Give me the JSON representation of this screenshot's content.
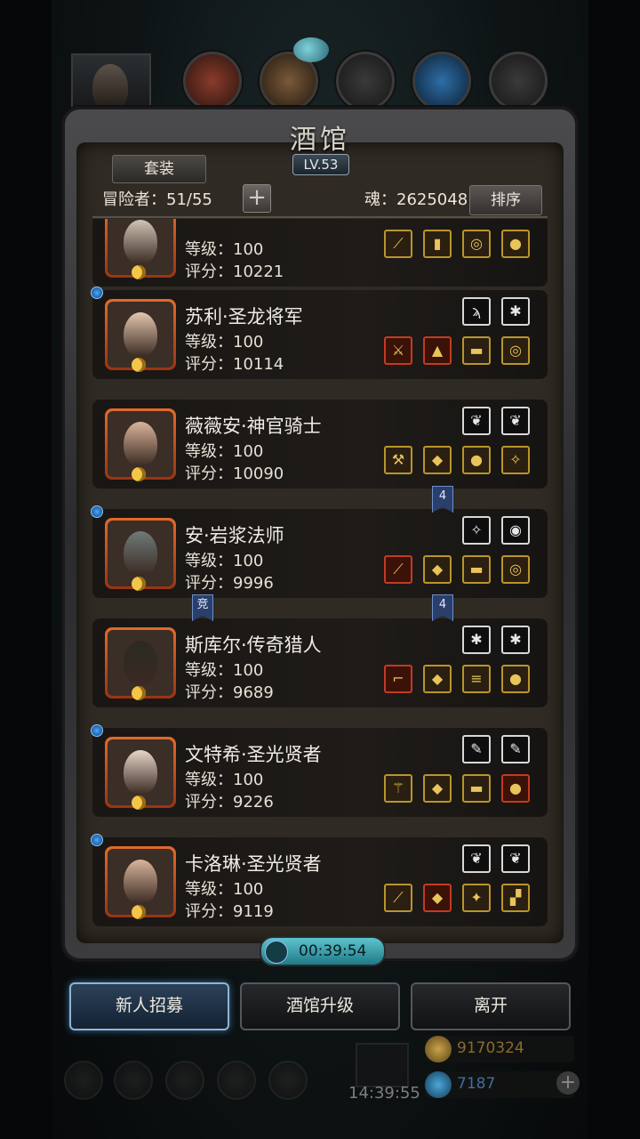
{
  "screen": {
    "title": "酒馆",
    "level_badge": "LV.53",
    "suit_button": "套装",
    "adventurer_label": "冒险者：51/55",
    "add_button": "+",
    "soul_label": "魂：2625048",
    "sort_button": "排序"
  },
  "heroes": [
    {
      "name": "",
      "level": "等级：100",
      "score": "评分：10221",
      "has_dot": false,
      "gear_top": [],
      "gear_bottom": [
        "staff",
        "cloak",
        "ring",
        "orb"
      ],
      "face_color": "#cfc4b6"
    },
    {
      "name": "苏利·圣龙将军",
      "level": "等级：100",
      "score": "评分：10114",
      "has_dot": true,
      "gear_top": [
        "claw",
        "totem"
      ],
      "gear_bottom": [
        "sword",
        "robe",
        "bracer",
        "ring"
      ],
      "face_color": "#e2c6ae"
    },
    {
      "name": "薇薇安·神官骑士",
      "level": "等级：100",
      "score": "评分：10090",
      "has_dot": false,
      "gear_top": [
        "feather",
        "feather"
      ],
      "gear_bottom": [
        "hammer",
        "armor",
        "orb",
        "amulet"
      ],
      "face_color": "#d9b39a"
    },
    {
      "name": "安·岩浆法师",
      "level": "等级：100",
      "score": "评分：9996",
      "has_dot": true,
      "gear_top": [
        "amulet",
        "shield"
      ],
      "gear_bottom": [
        "staff",
        "armor",
        "bracer",
        "ring"
      ],
      "face_color": "#6f7a78"
    },
    {
      "name": "斯库尔·传奇猎人",
      "level": "等级：100",
      "score": "评分：9689",
      "has_dot": false,
      "gear_top": [
        "totem",
        "totem"
      ],
      "gear_bottom": [
        "gun",
        "armor",
        "belt",
        "orb"
      ],
      "face_color": "#2a2a22"
    },
    {
      "name": "文特希·圣光贤者",
      "level": "等级：100",
      "score": "评分：9226",
      "has_dot": true,
      "gear_top": [
        "quill",
        "quill"
      ],
      "gear_bottom": [
        "scepter",
        "armor",
        "bracer",
        "orb"
      ],
      "face_color": "#e6d6c8"
    },
    {
      "name": "卡洛琳·圣光贤者",
      "level": "等级：100",
      "score": "评分：9119",
      "has_dot": true,
      "gear_top": [
        "feather",
        "feather"
      ],
      "gear_bottom": [
        "staff",
        "armor",
        "wand",
        "boots"
      ],
      "face_color": "#d8b49c"
    }
  ],
  "tags": [
    {
      "text": "4"
    },
    {
      "text": "竞"
    },
    {
      "text": "4"
    }
  ],
  "timer": "00:39:54",
  "buttons": {
    "recruit": "新人招募",
    "upgrade": "酒馆升级",
    "leave": "离开"
  },
  "dock": {
    "clock": "14:39:55",
    "gold": "9170324",
    "gems": "7187",
    "plus": "+"
  },
  "colors": {
    "rarity_gold": "#b9952a",
    "rarity_red": "#c43a22",
    "accent_blue": "#8fb4d6"
  }
}
